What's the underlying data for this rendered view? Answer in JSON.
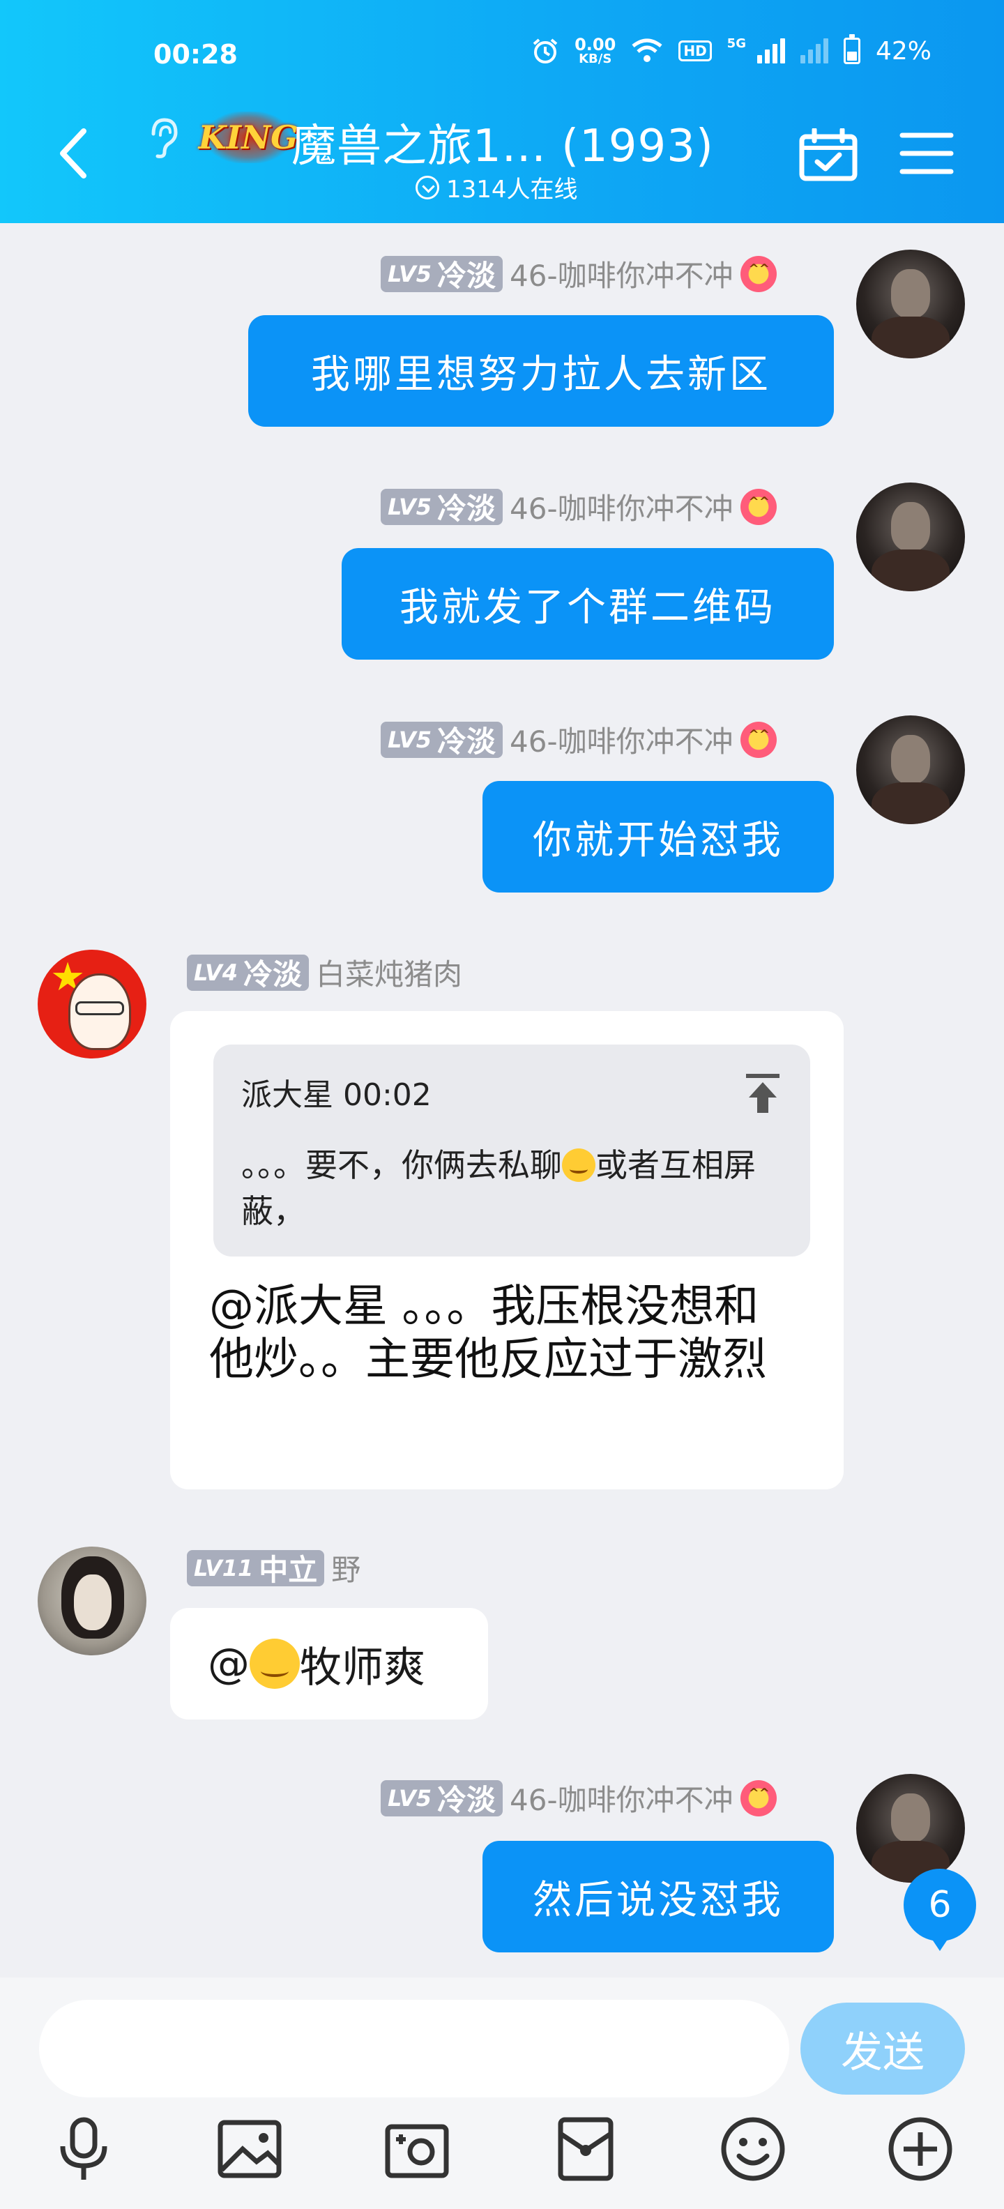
{
  "status_bar": {
    "time": "00:28",
    "net_speed": "0.00",
    "net_unit": "KB/S",
    "hd": "HD",
    "network": "5G",
    "battery": "42%"
  },
  "header": {
    "logo_text": "KING",
    "title": "魔兽之旅1... (1993)",
    "online": "1314人在线"
  },
  "messages": [
    {
      "side": "me",
      "level": "LV5",
      "level_title": "冷淡",
      "name": "46-咖啡你冲不冲",
      "text": "我哪里想努力拉人去新区"
    },
    {
      "side": "me",
      "level": "LV5",
      "level_title": "冷淡",
      "name": "46-咖啡你冲不冲",
      "text": "我就发了个群二维码"
    },
    {
      "side": "me",
      "level": "LV5",
      "level_title": "冷淡",
      "name": "46-咖啡你冲不冲",
      "text": "你就开始怼我"
    },
    {
      "side": "other",
      "level": "LV4",
      "level_title": "冷淡",
      "name": "白菜炖猪肉",
      "quote_header": "派大星 00:02",
      "quote_text_a": "。。。要不，你俩去私聊",
      "quote_text_b": "或者互相屏蔽，",
      "text": "@派大星 。。。我压根没想和他炒。。主要他反应过于激烈"
    },
    {
      "side": "other",
      "level": "LV11",
      "level_title": "中立",
      "name": "野",
      "text_prefix": "@",
      "text": " 牧师爽"
    },
    {
      "side": "me",
      "level": "LV5",
      "level_title": "冷淡",
      "name": "46-咖啡你冲不冲",
      "text": "然后说没怼我"
    }
  ],
  "unread_count": "6",
  "composer": {
    "placeholder": "",
    "send_label": "发送"
  },
  "toolbar_icons": [
    "microphone-icon",
    "image-icon",
    "camera-icon",
    "red-packet-icon",
    "emoji-icon",
    "plus-icon"
  ],
  "colors": {
    "header_start": "#12c7fb",
    "header_end": "#0b97f0",
    "my_bubble": "#0b93f7",
    "send_button": "#8fd1fb",
    "level_badge": "#a8adbc"
  }
}
